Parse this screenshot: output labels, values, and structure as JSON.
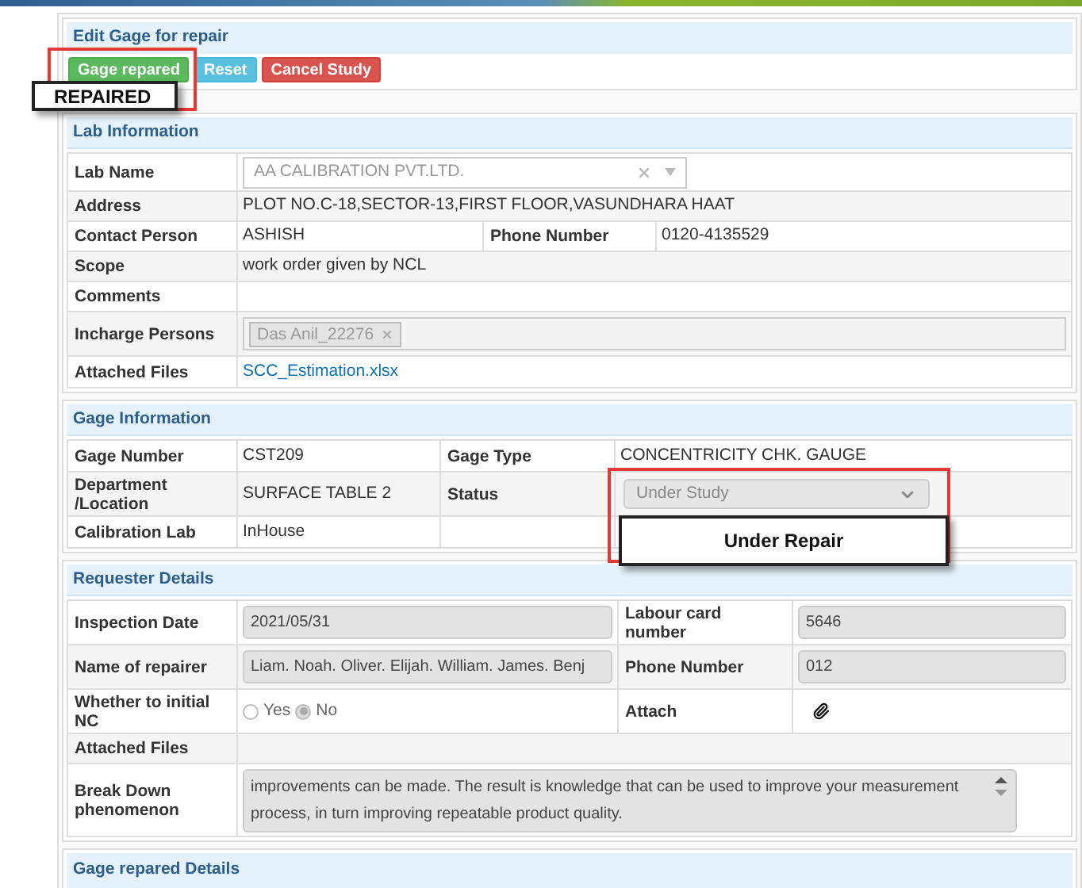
{
  "edit_panel": {
    "title": "Edit Gage for repair",
    "buttons": [
      {
        "label": "Gage repared",
        "kind": "success"
      },
      {
        "label": "Reset",
        "kind": "info"
      },
      {
        "label": "Cancel Study",
        "kind": "danger"
      }
    ]
  },
  "sections": [
    {
      "title": "Lab Information",
      "rows": [
        [
          {
            "label": "Lab Name",
            "kind": "select",
            "value": "AA CALIBRATION PVT.LTD."
          }
        ],
        [
          {
            "label": "Address",
            "kind": "text",
            "value": "PLOT NO.C-18,SECTOR-13,FIRST FLOOR,VASUNDHARA HAAT"
          }
        ],
        [
          {
            "label": "Contact Person",
            "kind": "text",
            "value": "ASHISH"
          },
          {
            "label": "Phone Number",
            "kind": "text",
            "value": "0120-4135529"
          }
        ],
        [
          {
            "label": "Scope",
            "kind": "text",
            "value": "work order given by NCL"
          }
        ],
        [
          {
            "label": "Comments",
            "kind": "text"
          }
        ],
        [
          {
            "label": "Incharge Persons",
            "kind": "tags",
            "tags": [
              "Das Anil_22276"
            ]
          }
        ],
        [
          {
            "label": "Attached Files",
            "kind": "link",
            "value": "SCC_Estimation.xlsx"
          }
        ]
      ]
    },
    {
      "title": "Gage Information",
      "rows": [
        [
          {
            "label": "Gage Number",
            "kind": "text",
            "value": "CST209"
          },
          {
            "label": "Gage Type",
            "kind": "text",
            "value": "CONCENTRICITY CHK. GAUGE"
          }
        ],
        [
          {
            "label": "Department /Location",
            "kind": "text",
            "value": "SURFACE TABLE 2"
          },
          {
            "label": "Status",
            "kind": "dropdown",
            "value": "Under Study"
          }
        ],
        [
          {
            "label": "Calibration Lab",
            "kind": "text",
            "value": "InHouse"
          },
          {
            "kind": "text"
          }
        ]
      ]
    },
    {
      "title": "Requester Details",
      "rows": [
        [
          {
            "label": "Inspection Date",
            "kind": "input",
            "value": "2021/05/31"
          },
          {
            "label": "Labour card number",
            "kind": "input",
            "value": "5646"
          }
        ],
        [
          {
            "label": "Name of repairer",
            "kind": "input",
            "value": "Liam. Noah. Oliver. Elijah. William. James. Benj"
          },
          {
            "label": "Phone Number",
            "kind": "input",
            "value": "012"
          }
        ],
        [
          {
            "label": "Whether to initial NC",
            "kind": "radio",
            "options": [
              {
                "label": "Yes",
                "selected": false
              },
              {
                "label": "No",
                "selected": true
              }
            ]
          },
          {
            "label": "Attach",
            "kind": "attach"
          }
        ],
        [
          {
            "label": "Attached Files",
            "kind": "text"
          }
        ],
        [
          {
            "label": "Break Down phenomenon",
            "kind": "textarea",
            "value": "improvements can be made. The result is knowledge that can be used to improve your measurement process, in turn improving repeatable product quality."
          }
        ]
      ]
    }
  ],
  "last_section": {
    "title": "Gage repared Details"
  },
  "annotations": [
    {
      "kind": "callout",
      "text": "REPAIRED"
    },
    {
      "kind": "callout",
      "text": "Under Repair"
    }
  ]
}
